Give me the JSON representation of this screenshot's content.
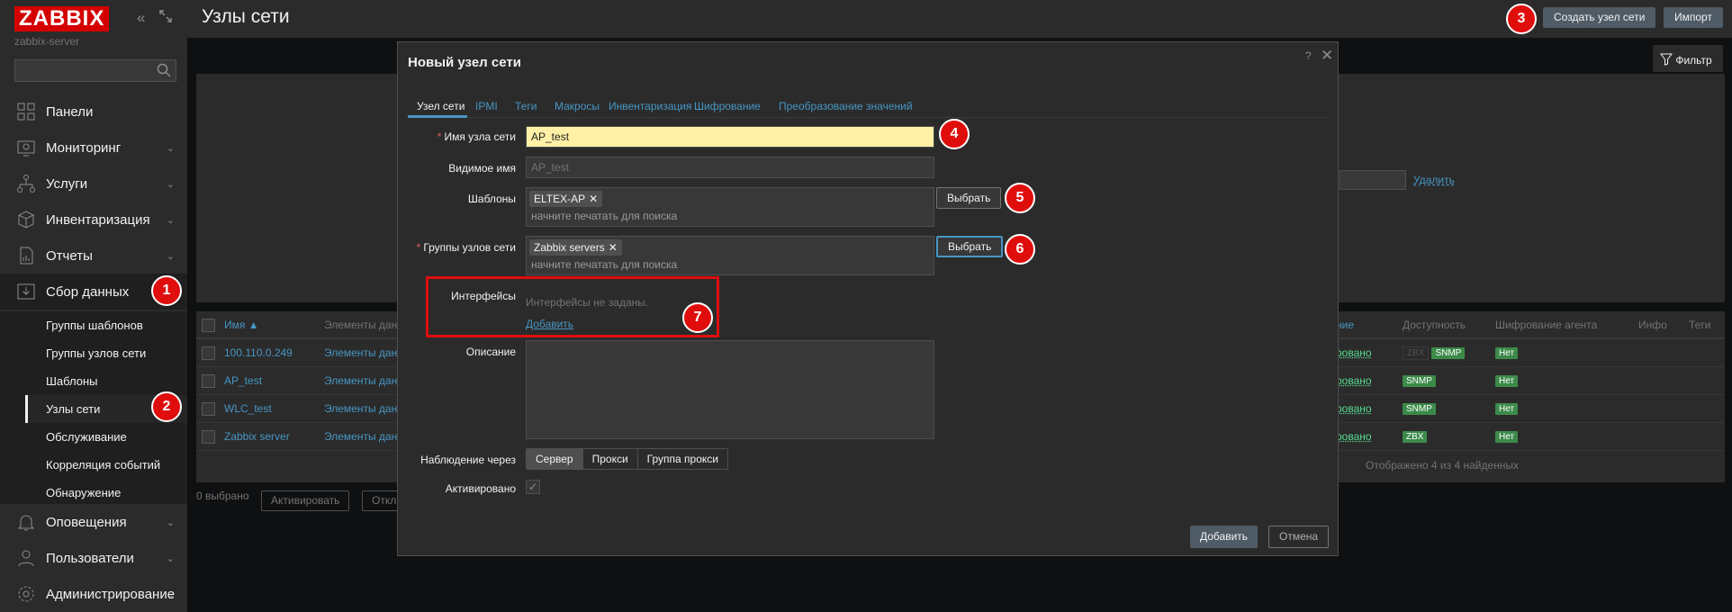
{
  "sidebar": {
    "logo": "ZABBIX",
    "server_name": "zabbix-server",
    "collapse_icon": "double-chevron-left-icon",
    "kiosk_icon": "expand-icon",
    "menu": [
      {
        "label": "Панели",
        "icon": "dashboard-icon"
      },
      {
        "label": "Мониторинг",
        "icon": "monitoring-icon"
      },
      {
        "label": "Услуги",
        "icon": "services-icon"
      },
      {
        "label": "Инвентаризация",
        "icon": "inventory-icon"
      },
      {
        "label": "Отчеты",
        "icon": "reports-icon"
      },
      {
        "label": "Сбор данных",
        "icon": "data-collection-icon"
      },
      {
        "label": "Оповещения",
        "icon": "bell-icon"
      },
      {
        "label": "Пользователи",
        "icon": "users-icon"
      },
      {
        "label": "Администрирование",
        "icon": "gear-icon"
      }
    ],
    "submenu": [
      "Группы шаблонов",
      "Группы узлов сети",
      "Шаблоны",
      "Узлы сети",
      "Обслуживание",
      "Корреляция событий",
      "Обнаружение"
    ]
  },
  "header": {
    "title": "Узлы сети",
    "create_button": "Создать узел сети",
    "import_button": "Импорт"
  },
  "filter": {
    "tab_label": "Фильтр",
    "remove_link": "Удалить"
  },
  "table": {
    "headers": {
      "name": "Имя ▲",
      "items": "Элементы дан",
      "status": "ние",
      "availability": "Доступность",
      "encryption": "Шифрование агента",
      "info": "Инфо",
      "tags": "Теги"
    },
    "rows": [
      {
        "name": "100.110.0.249",
        "items": "Элементы дан",
        "status": "ровано",
        "avail_grey": "ZBX",
        "avail": "SNMP",
        "encryption": "Нет"
      },
      {
        "name": "AP_test",
        "items": "Элементы дан",
        "status": "ровано",
        "avail_grey": "",
        "avail": "SNMP",
        "encryption": "Нет"
      },
      {
        "name": "WLC_test",
        "items": "Элементы дан",
        "status": "ровано",
        "avail_grey": "",
        "avail": "SNMP",
        "encryption": "Нет"
      },
      {
        "name": "Zabbix server",
        "items": "Элементы дан",
        "status": "ровано",
        "avail_grey": "",
        "avail": "ZBX",
        "encryption": "Нет"
      }
    ],
    "footer": "Отображено 4 из 4 найденных",
    "selected": "0 выбрано",
    "activate_button": "Активировать",
    "deactivate_button": "Откл"
  },
  "dialog": {
    "title": "Новый узел сети",
    "help": "?",
    "close": "✕",
    "tabs": [
      "Узел сети",
      "IPMI",
      "Теги",
      "Макросы",
      "Инвентаризация",
      "Шифрование",
      "Преобразование значений"
    ],
    "fields": {
      "host_name_label": "Имя узла сети",
      "host_name_value": "AP_test",
      "visible_name_label": "Видимое имя",
      "visible_name_placeholder": "AP_test",
      "templates_label": "Шаблоны",
      "templates_chip": "ELTEX-AP",
      "groups_label": "Группы узлов сети",
      "groups_chip": "Zabbix servers",
      "search_placeholder": "начните печатать для поиска",
      "select_button": "Выбрать",
      "interfaces_label": "Интерфейсы",
      "interfaces_empty": "Интерфейсы не заданы.",
      "interfaces_add": "Добавить",
      "description_label": "Описание",
      "monitored_by_label": "Наблюдение через",
      "monitored_by_options": [
        "Сервер",
        "Прокси",
        "Группа прокси"
      ],
      "enabled_label": "Активировано",
      "enabled_check": "✓"
    },
    "add_button": "Добавить",
    "cancel_button": "Отмена"
  },
  "annotations": [
    "1",
    "2",
    "3",
    "4",
    "5",
    "6",
    "7"
  ],
  "colors": {
    "accent": "#4796c4",
    "brand": "#d40000",
    "annotation": "#e00d0d",
    "status_green": "#3c8a4a"
  }
}
